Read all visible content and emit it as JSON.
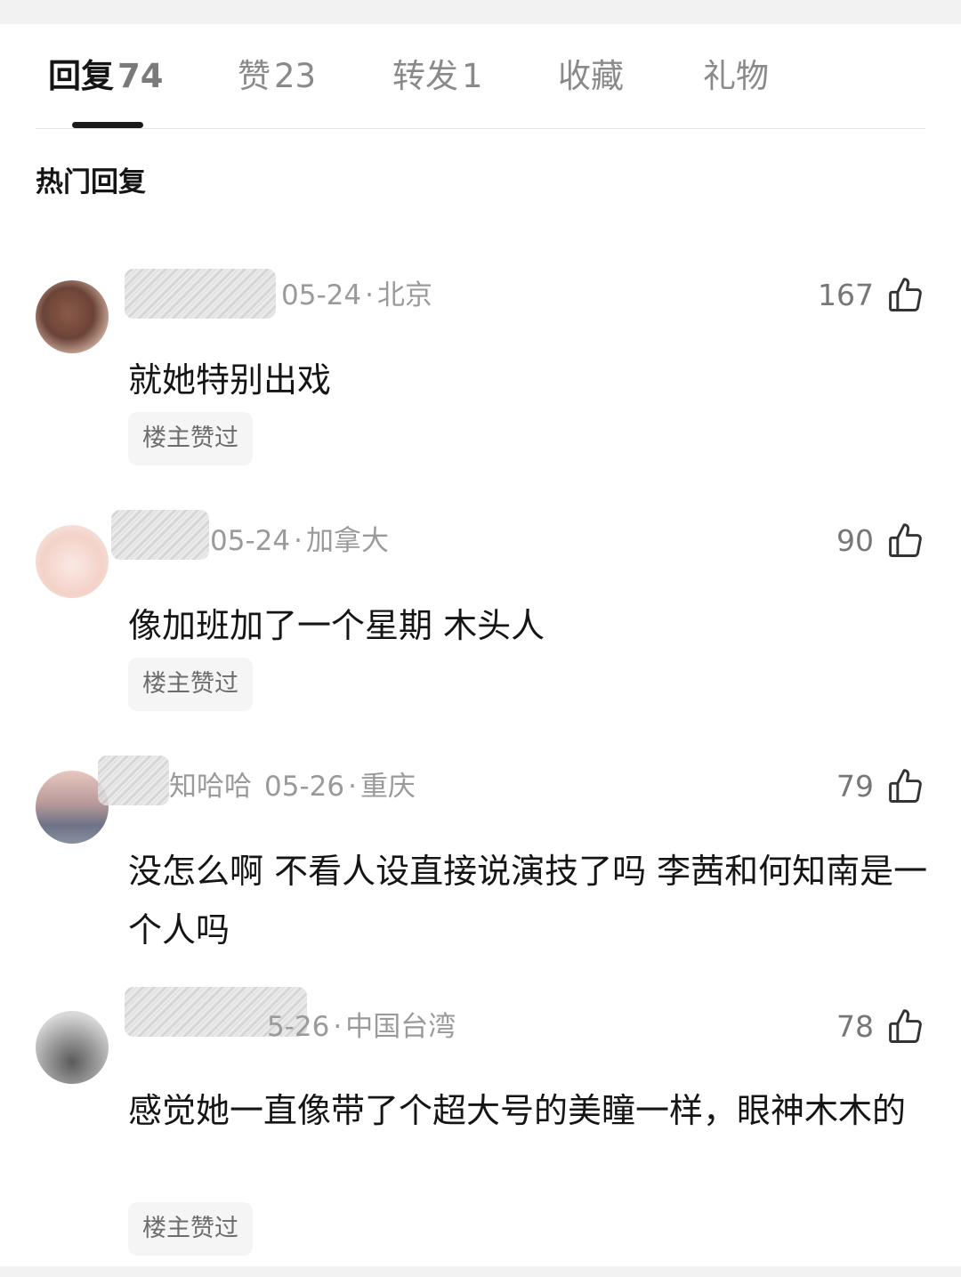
{
  "tabs": [
    {
      "label": "回复",
      "count": "74"
    },
    {
      "label": "赞",
      "count": "23"
    },
    {
      "label": "转发",
      "count": "1"
    },
    {
      "label": "收藏",
      "count": ""
    },
    {
      "label": "礼物",
      "count": ""
    }
  ],
  "section_title": "热门回复",
  "comments": [
    {
      "name_visible": "",
      "date": "05-24",
      "dot": "·",
      "location": "北京",
      "likes": "167",
      "text": "就她特别出戏",
      "badge": "楼主赞过"
    },
    {
      "name_visible": "",
      "date": "05-24",
      "dot": "·",
      "location": "加拿大",
      "likes": "90",
      "text": "像加班加了一个星期  木头人",
      "badge": "楼主赞过"
    },
    {
      "name_visible": "知哈哈",
      "date": "05-26",
      "dot": "·",
      "location": "重庆",
      "likes": "79",
      "text": "没怎么啊 不看人设直接说演技了吗 李茜和何知南是一个人吗",
      "badge": ""
    },
    {
      "name_visible": "",
      "date": "5-26",
      "dot": "·",
      "location": "中国台湾",
      "likes": "78",
      "text": "感觉她一直像带了个超大号的美瞳一样，眼神木木的",
      "badge": "楼主赞过"
    }
  ],
  "colors": {
    "active_tab": "#151515",
    "inactive_tab": "#8a8a8a",
    "meta": "#9a9a9a",
    "badge_bg": "#f5f5f5",
    "background": "#f2f2f2"
  },
  "icons": {
    "like": "thumbs-up-icon"
  }
}
